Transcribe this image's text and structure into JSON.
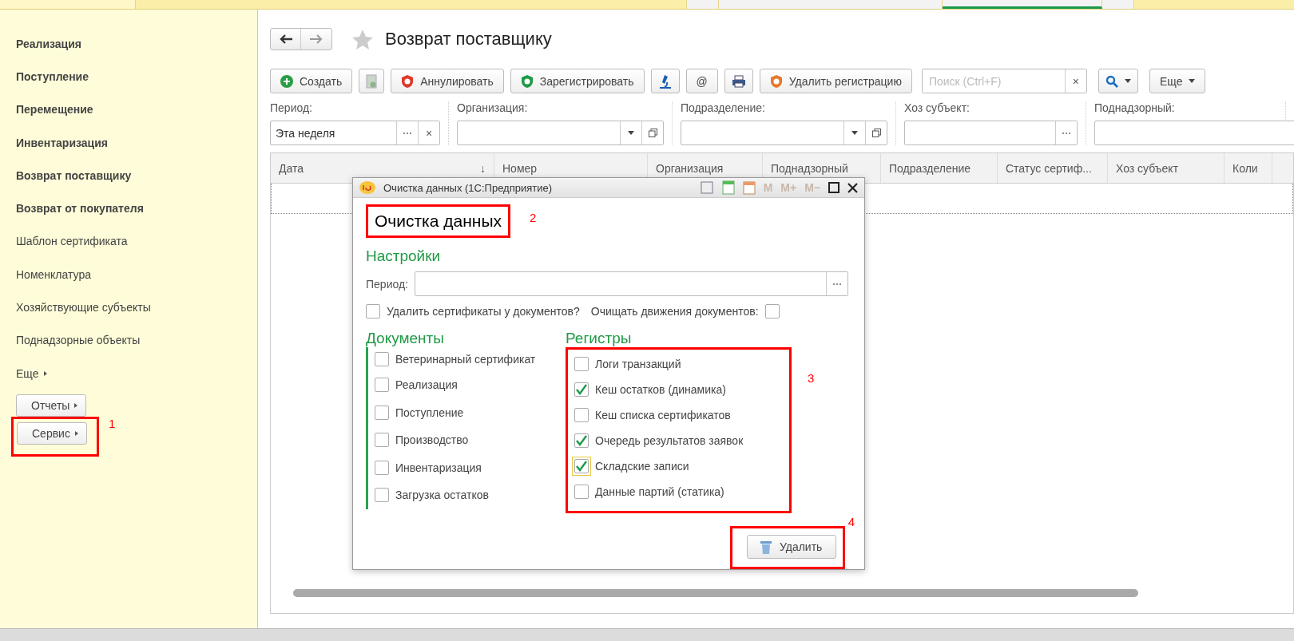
{
  "sidebar": {
    "items": [
      {
        "label": "Реализация",
        "bold": true
      },
      {
        "label": "Поступление",
        "bold": true
      },
      {
        "label": "Перемещение",
        "bold": true
      },
      {
        "label": "Инвентаризация",
        "bold": true
      },
      {
        "label": "Возврат поставщику",
        "bold": true
      },
      {
        "label": "Возврат от покупателя",
        "bold": true
      },
      {
        "label": "Шаблон сертификата",
        "bold": false
      },
      {
        "label": "Номенклатура",
        "bold": false
      },
      {
        "label": "Хозяйствующие субъекты",
        "bold": false
      },
      {
        "label": "Поднадзорные объекты",
        "bold": false
      }
    ],
    "more": "Еще",
    "buttons": [
      {
        "label": "Отчеты"
      },
      {
        "label": "Сервис",
        "annotation": "1"
      }
    ]
  },
  "header": {
    "title": "Возврат поставщику"
  },
  "toolbar": {
    "buttons": [
      {
        "kind": "text",
        "label": "Создать"
      },
      {
        "kind": "icon"
      },
      {
        "kind": "text",
        "label": "Аннулировать"
      },
      {
        "kind": "text",
        "label": "Зарегистрировать"
      },
      {
        "kind": "icon"
      },
      {
        "kind": "text",
        "label": "@"
      },
      {
        "kind": "icon"
      },
      {
        "kind": "text",
        "label": "Удалить регистрацию"
      }
    ],
    "search": {
      "placeholder": "Поиск (Ctrl+F)",
      "clear": "×"
    },
    "more": "Еще"
  },
  "filters": [
    {
      "label": "Период:",
      "value": "Эта неделя",
      "clear": "×",
      "kind": "choice"
    },
    {
      "label": "Организация:",
      "kind": "dropdown"
    },
    {
      "label": "Подразделение:",
      "kind": "dropdown"
    },
    {
      "label": "Хоз субъект:",
      "kind": "choice-short"
    },
    {
      "label": "Поднадзорный:",
      "kind": "cut"
    }
  ],
  "table": {
    "columns": [
      {
        "label": "Дата",
        "sort_mark": "↓"
      },
      {
        "label": "Номер"
      },
      {
        "label": "Организация"
      },
      {
        "label": "Поднадзорный"
      },
      {
        "label": "Подразделение"
      },
      {
        "label": "Статус сертиф..."
      },
      {
        "label": "Хоз субъект"
      },
      {
        "label": "Коли"
      }
    ]
  },
  "dialog": {
    "window_title": "Очистка данных  (1С:Предприятие)",
    "memory_buttons": [
      "M",
      "M+",
      "M−"
    ],
    "heading": "Очистка данных",
    "heading_annotation": "2",
    "settings_title": "Настройки",
    "period_label": "Период:",
    "options": [
      {
        "label": "Удалить сертификаты у документов?",
        "checked": false
      },
      {
        "label": "Очищать движения документов:",
        "checked": false
      }
    ],
    "documents_title": "Документы",
    "documents": [
      {
        "label": "Ветеринарный сертификат",
        "checked": false
      },
      {
        "label": "Реализация",
        "checked": false
      },
      {
        "label": "Поступление",
        "checked": false
      },
      {
        "label": "Производство",
        "checked": false
      },
      {
        "label": "Инвентаризация",
        "checked": false
      },
      {
        "label": "Загрузка остатков",
        "checked": false
      }
    ],
    "registers_title": "Регистры",
    "registers_annotation": "3",
    "registers": [
      {
        "label": "Логи транзакций",
        "checked": false,
        "focused": false
      },
      {
        "label": "Кеш остатков (динамика)",
        "checked": true,
        "focused": false
      },
      {
        "label": "Кеш списка сертификатов",
        "checked": false,
        "focused": false
      },
      {
        "label": "Очередь результатов заявок",
        "checked": true,
        "focused": false
      },
      {
        "label": "Складские записи",
        "checked": true,
        "focused": true
      },
      {
        "label": "Данные партий (статика)",
        "checked": false,
        "focused": false
      }
    ],
    "delete_button": "Удалить",
    "delete_annotation": "4"
  }
}
